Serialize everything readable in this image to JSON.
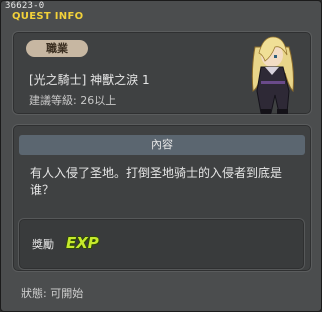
{
  "window": {
    "quest_id": "36623-0",
    "title": "QUEST INFO"
  },
  "quest": {
    "job_badge": "職業",
    "name": "[光之騎士] 神獸之淚 1",
    "recommended_level": "建議等級: 26以上",
    "npc_icon": "blonde-knight-npc-portrait"
  },
  "content": {
    "header": "內容",
    "description": "有人入侵了圣地。打倒圣地骑士的入侵者到底是谁？"
  },
  "reward": {
    "label": "獎勵",
    "exp_icon_text": "EXP"
  },
  "status": {
    "text": "狀態: 可開始"
  },
  "colors": {
    "title": "#f2d13a",
    "exp": "#c6ea2c",
    "badge": "#c7b7a2"
  }
}
